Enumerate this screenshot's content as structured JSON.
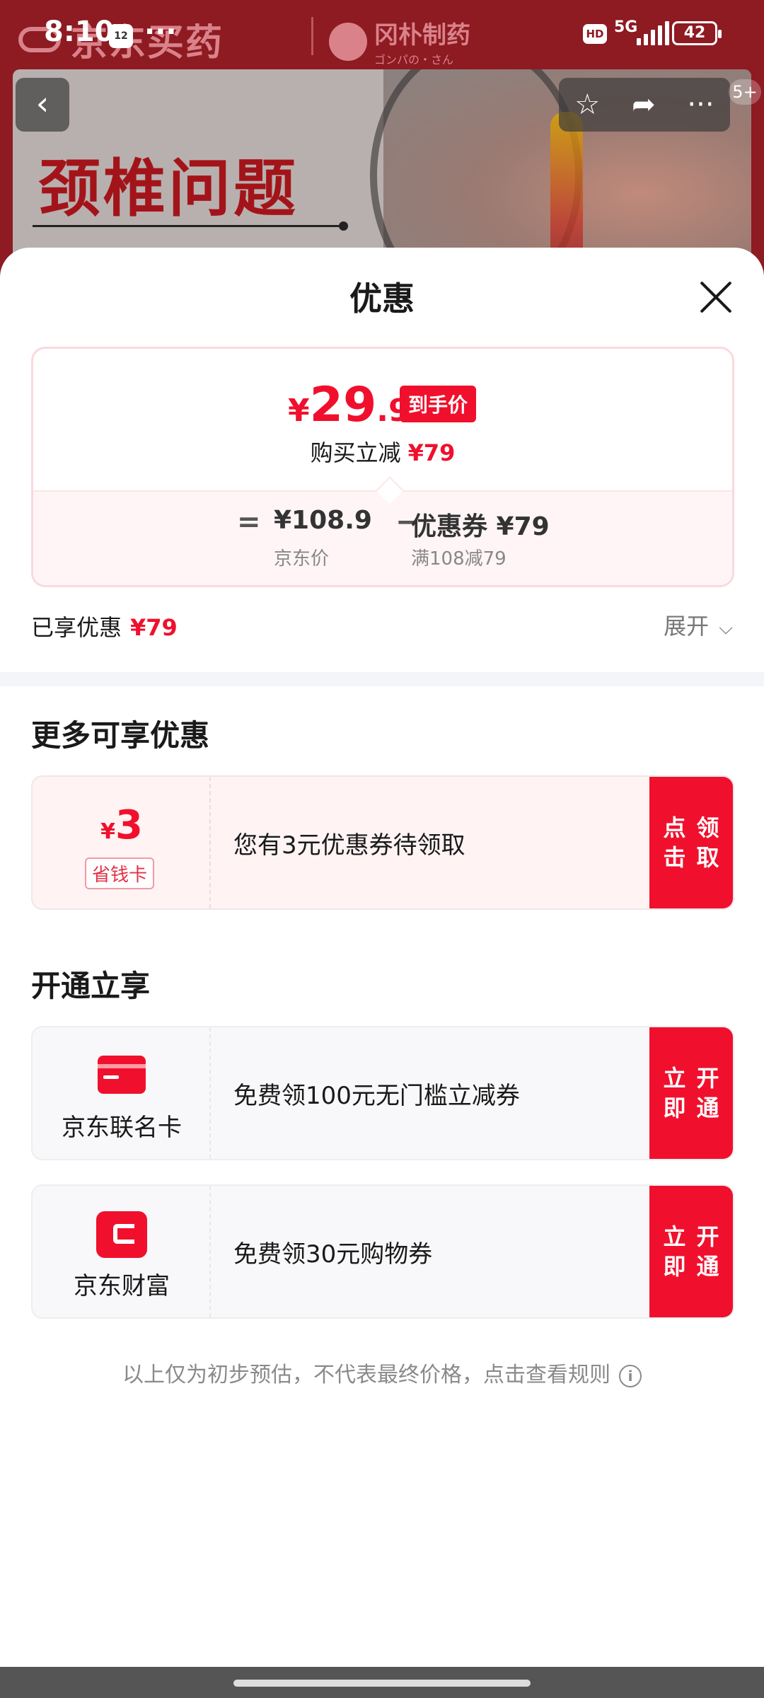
{
  "status_bar": {
    "time": "8:10",
    "notification_badge": "12",
    "more_dots": "···",
    "hd_label": "HD",
    "network": "5G",
    "battery": "42"
  },
  "background": {
    "store_name": "京东买药",
    "brand_name": "冈朴制药",
    "brand_sub": "ゴンパの・さん",
    "banner_headline": "颈椎问题",
    "more_badge": "5+"
  },
  "sheet": {
    "title": "优惠",
    "final_price": {
      "yen": "¥",
      "int": "29",
      "dec": ".9",
      "tag": "到手价"
    },
    "reduce": {
      "label": "购买立减",
      "amount": "¥79"
    },
    "formula": {
      "eq": "=",
      "jd_price": "¥108.9",
      "jd_price_label": "京东价",
      "minus": "−",
      "coupon_value": "优惠券 ¥79",
      "coupon_rule": "满108减79"
    },
    "enjoyed": {
      "label": "已享优惠",
      "amount": "¥79"
    },
    "expand_label": "展开"
  },
  "more_offers": {
    "title": "更多可享优惠",
    "items": [
      {
        "yen": "¥",
        "amount": "3",
        "tag": "省钱卡",
        "text": "您有3元优惠券待领取",
        "action": "点击领取"
      }
    ]
  },
  "activate": {
    "title": "开通立享",
    "items": [
      {
        "icon": "credit-card-icon",
        "name": "京东联名卡",
        "text": "免费领100元无门槛立减券",
        "action": "立即开通"
      },
      {
        "icon": "jd-wealth-icon",
        "name": "京东财富",
        "text": "免费领30元购物券",
        "action": "立即开通"
      }
    ]
  },
  "disclaimer": "以上仅为初步预估，不代表最终价格，点击查看规则",
  "colors": {
    "accent": "#f0102d",
    "pink_bg": "#fff3f4",
    "gray_bg": "#f8f8fa"
  }
}
